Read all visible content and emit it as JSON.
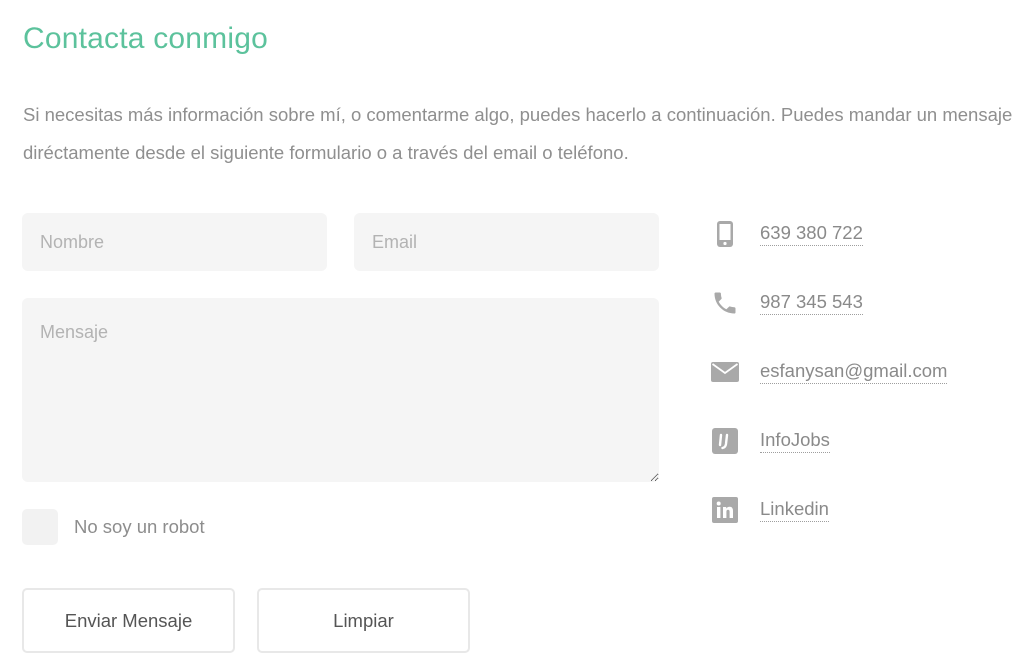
{
  "page": {
    "title": "Contacta conmigo",
    "intro": "Si necesitas más información sobre mí, o comentarme algo, puedes hacerlo a continuación. Puedes mandar un mensaje diréctamente desde el siguiente formulario o a través del email o teléfono."
  },
  "form": {
    "name_placeholder": "Nombre",
    "name_value": "",
    "email_placeholder": "Email",
    "email_value": "",
    "message_placeholder": "Mensaje",
    "message_value": "",
    "captcha_label": "No soy un robot",
    "captcha_checked": false,
    "send_label": "Enviar Mensaje",
    "clear_label": "Limpiar"
  },
  "contact": {
    "mobile": "639 380 722",
    "phone": "987 345 543",
    "email": "esfanysan@gmail.com",
    "infojobs": "InfoJobs",
    "linkedin": "Linkedin",
    "icons": {
      "mobile": "mobile-phone-icon",
      "phone": "phone-icon",
      "email": "envelope-icon",
      "infojobs": "infojobs-icon",
      "linkedin": "linkedin-icon"
    }
  },
  "colors": {
    "accent": "#5cc29c",
    "text": "#8a8a8a",
    "field_bg": "#f5f5f5",
    "icon": "#a9a9a9"
  }
}
